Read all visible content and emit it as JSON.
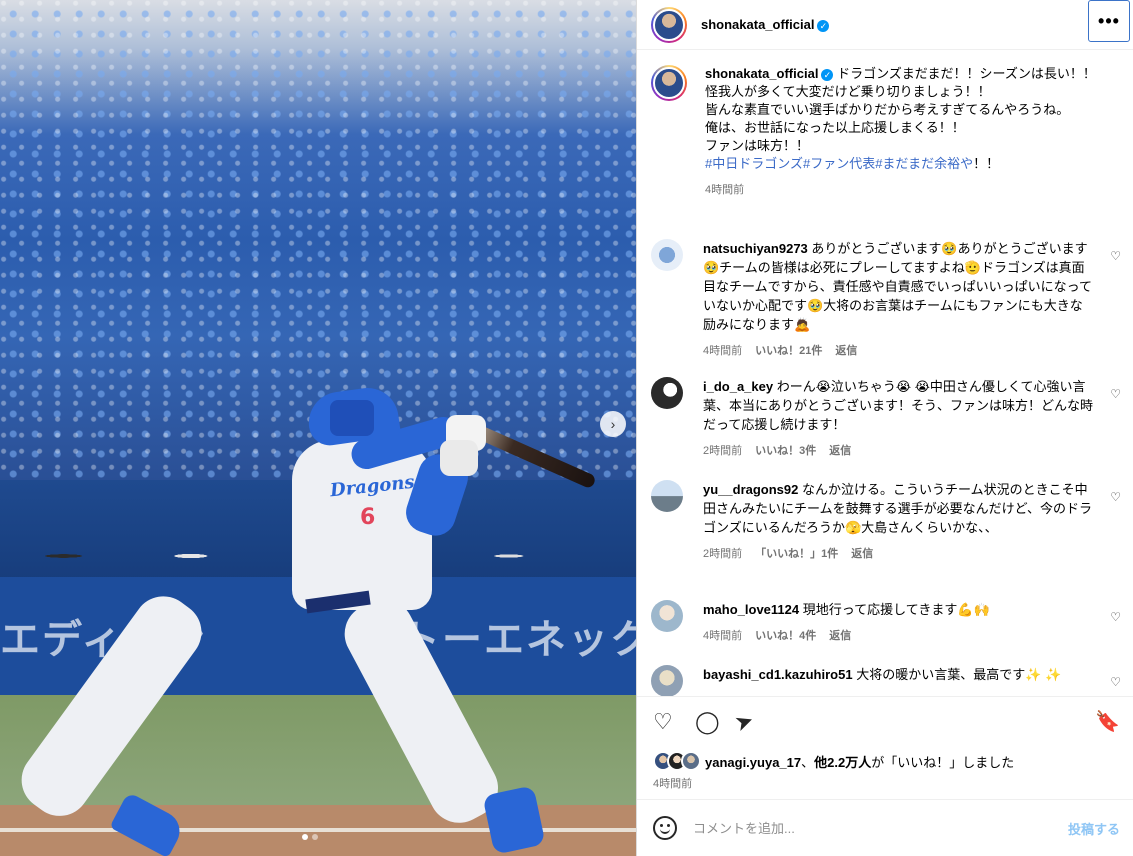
{
  "post": {
    "username": "shonakata_official",
    "verified_mark": "✓",
    "more_label": "•••",
    "caption_lines": [
      "ドラゴンズまだまだ！！シーズンは長い！！",
      "怪我人が多くて大変だけど乗り切りましょう！！",
      "皆んな素直でいい選手ばかりだから考えすぎてるんやろうね。",
      "俺は、お世話になった以上応援しまくる！！",
      "ファンは味方！！"
    ],
    "hashtags": "#中日ドラゴンズ#ファン代表#まだまだ余裕や",
    "hashtags_suffix": "！！",
    "caption_time": "4時間前"
  },
  "photo": {
    "banner_left": "エディオン",
    "banner_right": "トーエネック",
    "jersey_team": "Dragons",
    "jersey_number": "6",
    "next_icon": "›",
    "slide_count": 2,
    "active_slide": 1
  },
  "comments": [
    {
      "username": "natsuchiyan9273",
      "text": "ありがとうございます🥹ありがとうございます🥹チームの皆様は必死にプレーしてますよね🫡ドラゴンズは真面目なチームですから、責任感や自責感でいっぱいいっぱいになっていないか心配です🥹大将のお言葉はチームにもファンにも大きな励みになります🙇",
      "time": "4時間前",
      "likes": "いいね！21件",
      "reply": "返信"
    },
    {
      "username": "i_do_a_key",
      "text": "わーん😭泣いちゃう😭 😭中田さん優しくて心強い言葉、本当にありがとうございます！そう、ファンは味方！どんな時だって応援し続けます！",
      "time": "2時間前",
      "likes": "いいね！3件",
      "reply": "返信"
    },
    {
      "username": "yu__dragons92",
      "text": "なんか泣ける。こういうチーム状況のときこそ中田さんみたいにチームを鼓舞する選手が必要なんだけど、今のドラゴンズにいるんだろうか🫣大島さんくらいかな、、",
      "time": "2時間前",
      "likes": "「いいね！」1件",
      "reply": "返信"
    },
    {
      "username": "maho_love1124",
      "text": "現地行って応援してきます💪🙌",
      "time": "4時間前",
      "likes": "いいね！4件",
      "reply": "返信"
    },
    {
      "username": "bayashi_cd1.kazuhiro51",
      "text": "大将の暖かい言葉、最高です✨ ✨",
      "time": "",
      "likes": "",
      "reply": ""
    }
  ],
  "heart_icon": "♡",
  "actions": {
    "like_icon": "heart-icon",
    "comment_icon": "comment-icon",
    "share_icon": "share-icon",
    "save_icon": "bookmark-icon",
    "like_glyph": "♡",
    "comment_glyph": "◯",
    "share_glyph": "➤",
    "save_glyph": "🔖",
    "liked_by_user": "yanagi.yuya_17",
    "liked_by_joiner": "、",
    "liked_by_others": "他2.2万人",
    "liked_by_suffix": "が「いいね！」しました",
    "post_time": "4時間前"
  },
  "composer": {
    "placeholder": "コメントを追加...",
    "post_label": "投稿する"
  },
  "colors": {
    "accent": "#0095f6",
    "hashtag": "#3b6ac7",
    "post_button": "#8fc6f5",
    "muted": "#737373"
  }
}
